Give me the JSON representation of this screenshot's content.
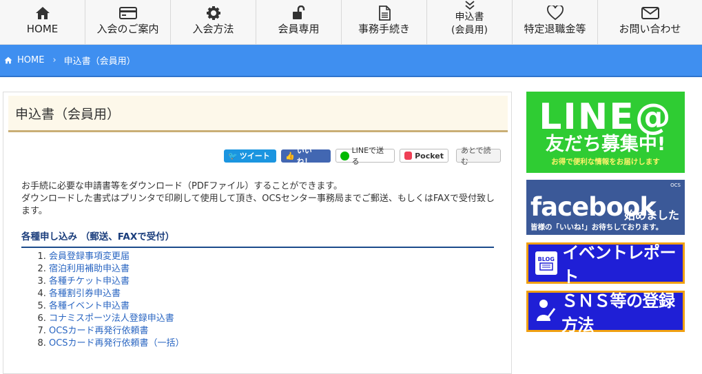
{
  "nav": [
    {
      "label": "HOME",
      "icon": "home-icon"
    },
    {
      "label": "入会のご案内",
      "icon": "credit-card-icon"
    },
    {
      "label": "入会方法",
      "icon": "gear-icon"
    },
    {
      "label": "会員専用",
      "icon": "unlock-icon"
    },
    {
      "label": "事務手続き",
      "icon": "document-icon"
    },
    {
      "label": "申込書\n(会員用)",
      "icon": "double-chevron-down-icon"
    },
    {
      "label": "特定退職金等",
      "icon": "heart-icon"
    },
    {
      "label": "お問い合わせ",
      "icon": "envelope-icon"
    }
  ],
  "breadcrumb": {
    "home": "HOME",
    "current": "申込書（会員用）"
  },
  "page": {
    "title": "申込書（会員用）"
  },
  "share": {
    "tweet": "ツイート",
    "like": "いいね！",
    "line": "LINEで送る",
    "pocket": "Pocket",
    "later": "あとで読む"
  },
  "intro": {
    "line1": "お手続に必要な申請書等をダウンロード（PDFファイル）することができます。",
    "line2": "ダウンロードした書式はプリンタで印刷して使用して頂き、OCSセンター事務局までご郵送、もしくはFAXで受付致します。"
  },
  "section": {
    "heading": "各種申し込み （郵送、FAXで受付）"
  },
  "forms": [
    "会員登録事項変更届",
    "宿泊利用補助申込書",
    "各種チケット申込書",
    "各種割引券申込書",
    "各種イベント申込書",
    "コナミスポーツ法人登録申込書",
    "OCSカード再発行依頼書",
    "OCSカード再発行依頼書（一括）"
  ],
  "banners": {
    "line": {
      "big": "LINE@",
      "mid": "友だち募集中!",
      "small": "お得で便利な情報をお届けします"
    },
    "facebook": {
      "big": "facebook",
      "right": "始めました",
      "ocs": "OCS",
      "small": "皆様の「いいね!」お待ちしております。"
    },
    "event": {
      "icon_text": "BLOG",
      "text": "イベントレポート"
    },
    "sns": {
      "text": "ＳＮＳ等の登録方法"
    }
  },
  "colors": {
    "accent_blue": "#3f8ff0",
    "title_underline": "#c9ae75",
    "link": "#2a66c2",
    "line_green": "#2fcc33",
    "facebook_blue": "#3b5998",
    "banner_blue": "#1f1fd6",
    "banner_border": "#f0a012"
  }
}
